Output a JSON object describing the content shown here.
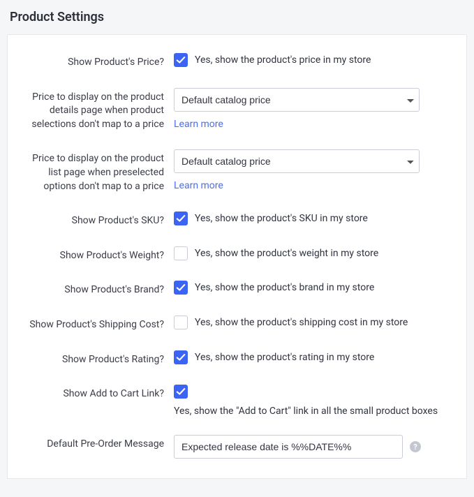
{
  "section_title": "Product Settings",
  "rows": {
    "price": {
      "label": "Show Product's Price?",
      "text": "Yes, show the product's price in my store"
    },
    "detail_price": {
      "label": "Price to display on the product details page when product selections don't map to a price",
      "selected": "Default catalog price",
      "learn": "Learn more"
    },
    "list_price": {
      "label": "Price to display on the product list page when preselected options don't map to a price",
      "selected": "Default catalog price",
      "learn": "Learn more"
    },
    "sku": {
      "label": "Show Product's SKU?",
      "text": "Yes, show the product's SKU in my store"
    },
    "weight": {
      "label": "Show Product's Weight?",
      "text": "Yes, show the product's weight in my store"
    },
    "brand": {
      "label": "Show Product's Brand?",
      "text": "Yes, show the product's brand in my store"
    },
    "shipping": {
      "label": "Show Product's Shipping Cost?",
      "text": "Yes, show the product's shipping cost in my store"
    },
    "rating": {
      "label": "Show Product's Rating?",
      "text": "Yes, show the product's rating in my store"
    },
    "cart": {
      "label": "Show Add to Cart Link?",
      "text": "Yes, show the \"Add to Cart\" link in all the small product boxes"
    },
    "preorder": {
      "label": "Default Pre-Order Message",
      "value": "Expected release date is %%DATE%%"
    }
  }
}
